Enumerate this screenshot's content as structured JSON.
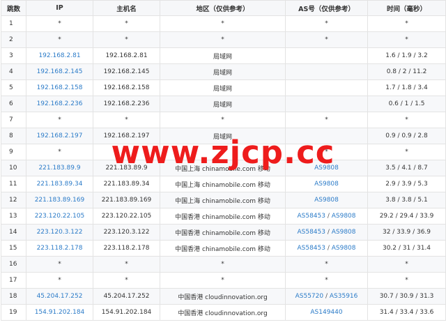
{
  "headers": [
    "跳数",
    "IP",
    "主机名",
    "地区（仅供参考）",
    "AS号（仅供参考）",
    "时间（毫秒）"
  ],
  "watermark": "www.zjcp.cc",
  "rows": [
    {
      "hop": "1",
      "ip": "*",
      "ip_link": false,
      "host": "*",
      "region": "*",
      "as": [
        "*"
      ],
      "as_link": false,
      "time": "*"
    },
    {
      "hop": "2",
      "ip": "*",
      "ip_link": false,
      "host": "*",
      "region": "*",
      "as": [
        "*"
      ],
      "as_link": false,
      "time": "*"
    },
    {
      "hop": "3",
      "ip": "192.168.2.81",
      "ip_link": true,
      "host": "192.168.2.81",
      "region": "局域网",
      "as": [],
      "as_link": false,
      "time": "1.6 / 1.9 / 3.2"
    },
    {
      "hop": "4",
      "ip": "192.168.2.145",
      "ip_link": true,
      "host": "192.168.2.145",
      "region": "局域网",
      "as": [],
      "as_link": false,
      "time": "0.8 / 2 / 11.2"
    },
    {
      "hop": "5",
      "ip": "192.168.2.158",
      "ip_link": true,
      "host": "192.168.2.158",
      "region": "局域网",
      "as": [],
      "as_link": false,
      "time": "1.7 / 1.8 / 3.4"
    },
    {
      "hop": "6",
      "ip": "192.168.2.236",
      "ip_link": true,
      "host": "192.168.2.236",
      "region": "局域网",
      "as": [],
      "as_link": false,
      "time": "0.6 / 1 / 1.5"
    },
    {
      "hop": "7",
      "ip": "*",
      "ip_link": false,
      "host": "*",
      "region": "*",
      "as": [
        "*"
      ],
      "as_link": false,
      "time": "*"
    },
    {
      "hop": "8",
      "ip": "192.168.2.197",
      "ip_link": true,
      "host": "192.168.2.197",
      "region": "局域网",
      "as": [],
      "as_link": false,
      "time": "0.9 / 0.9 / 2.8"
    },
    {
      "hop": "9",
      "ip": "*",
      "ip_link": false,
      "host": "*",
      "region": "*",
      "as": [
        "*"
      ],
      "as_link": false,
      "time": "*"
    },
    {
      "hop": "10",
      "ip": "221.183.89.9",
      "ip_link": true,
      "host": "221.183.89.9",
      "region": "中国上海 chinamobile.com 移动",
      "as": [
        "AS9808"
      ],
      "as_link": true,
      "time": "3.5 / 4.1 / 8.7"
    },
    {
      "hop": "11",
      "ip": "221.183.89.34",
      "ip_link": true,
      "host": "221.183.89.34",
      "region": "中国上海 chinamobile.com 移动",
      "as": [
        "AS9808"
      ],
      "as_link": true,
      "time": "2.9 / 3.9 / 5.3"
    },
    {
      "hop": "12",
      "ip": "221.183.89.169",
      "ip_link": true,
      "host": "221.183.89.169",
      "region": "中国上海 chinamobile.com 移动",
      "as": [
        "AS9808"
      ],
      "as_link": true,
      "time": "3.8 / 3.8 / 5.1"
    },
    {
      "hop": "13",
      "ip": "223.120.22.105",
      "ip_link": true,
      "host": "223.120.22.105",
      "region": "中国香港 chinamobile.com 移动",
      "as": [
        "AS58453",
        "AS9808"
      ],
      "as_link": true,
      "time": "29.2 / 29.4 / 33.9"
    },
    {
      "hop": "14",
      "ip": "223.120.3.122",
      "ip_link": true,
      "host": "223.120.3.122",
      "region": "中国香港 chinamobile.com 移动",
      "as": [
        "AS58453",
        "AS9808"
      ],
      "as_link": true,
      "time": "32 / 33.9 / 36.9"
    },
    {
      "hop": "15",
      "ip": "223.118.2.178",
      "ip_link": true,
      "host": "223.118.2.178",
      "region": "中国香港 chinamobile.com 移动",
      "as": [
        "AS58453",
        "AS9808"
      ],
      "as_link": true,
      "time": "30.2 / 31 / 31.4"
    },
    {
      "hop": "16",
      "ip": "*",
      "ip_link": false,
      "host": "*",
      "region": "*",
      "as": [
        "*"
      ],
      "as_link": false,
      "time": "*"
    },
    {
      "hop": "17",
      "ip": "*",
      "ip_link": false,
      "host": "*",
      "region": "*",
      "as": [
        "*"
      ],
      "as_link": false,
      "time": "*"
    },
    {
      "hop": "18",
      "ip": "45.204.17.252",
      "ip_link": true,
      "host": "45.204.17.252",
      "region": "中国香港 cloudinnovation.org",
      "as": [
        "AS55720",
        "AS35916"
      ],
      "as_link": true,
      "time": "30.7 / 30.9 / 31.3"
    },
    {
      "hop": "19",
      "ip": "154.91.202.184",
      "ip_link": true,
      "host": "154.91.202.184",
      "region": "中国香港 cloudinnovation.org",
      "as": [
        "AS149440"
      ],
      "as_link": true,
      "time": "31.4 / 33.4 / 33.6"
    }
  ]
}
